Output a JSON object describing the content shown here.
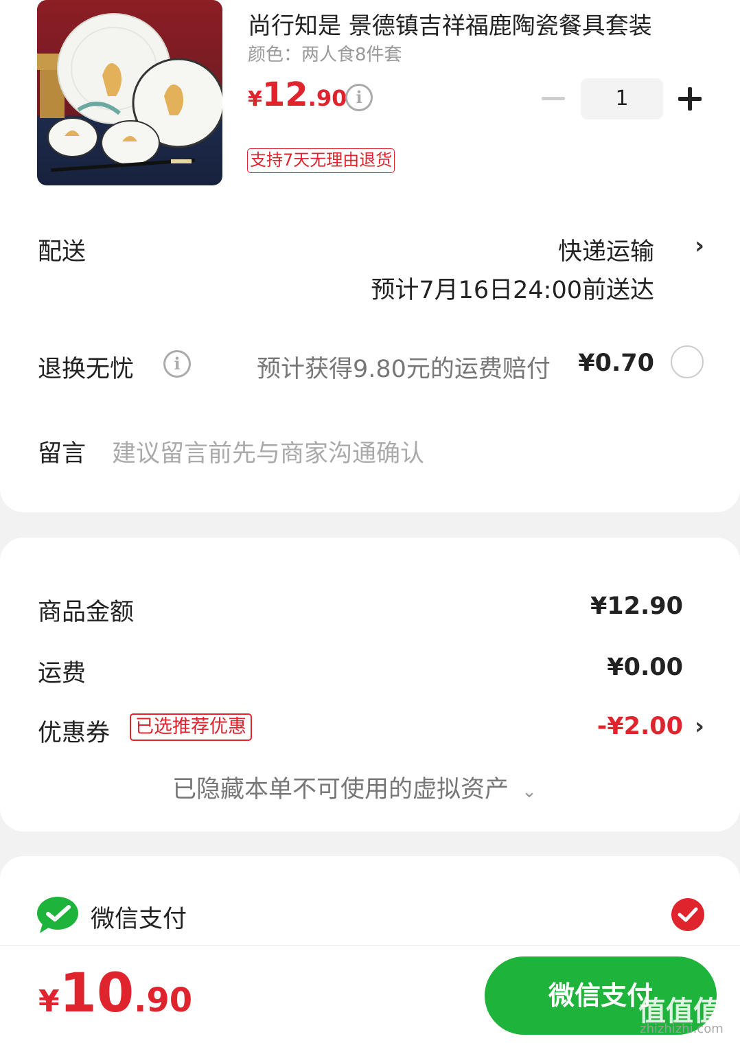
{
  "product": {
    "title": "尚行知是 景德镇吉祥福鹿陶瓷餐具套装",
    "spec": "颜色：两人食8件套",
    "price_currency": "¥",
    "price_int": "12",
    "price_dec": ".90",
    "info_glyph": "i",
    "quantity": "1",
    "return_policy": "支持7天无理由退货"
  },
  "delivery": {
    "label": "配送",
    "method": "快递运输",
    "eta": "预计7月16日24:00前送达"
  },
  "return_insurance": {
    "label": "退换无忧",
    "info_glyph": "i",
    "desc": "预计获得9.80元的运费赔付",
    "price": "¥0.70"
  },
  "message": {
    "label": "留言",
    "placeholder": "建议留言前先与商家沟通确认"
  },
  "amounts": {
    "goods_label": "商品金额",
    "goods_value": "¥12.90",
    "shipping_label": "运费",
    "shipping_value": "¥0.00",
    "coupon_label": "优惠券",
    "coupon_badge": "已选推荐优惠",
    "coupon_value": "-¥2.00",
    "hidden_assets": "已隐藏本单不可使用的虚拟资产"
  },
  "payment": {
    "method_label": "微信支付"
  },
  "bottom_bar": {
    "total_currency": "¥",
    "total_int": "10",
    "total_dec": ".90",
    "pay_button": "微信支付",
    "watermark": "值值值",
    "watermark_url": "zhizhizhi.com"
  },
  "colors": {
    "accent_red": "#e0242e",
    "wechat_green": "#1eb33a"
  },
  "icons": [
    "info-icon",
    "minus-icon",
    "plus-icon",
    "chevron-right-icon",
    "radio-icon",
    "chevron-down-icon",
    "wechat-icon",
    "check-icon"
  ]
}
